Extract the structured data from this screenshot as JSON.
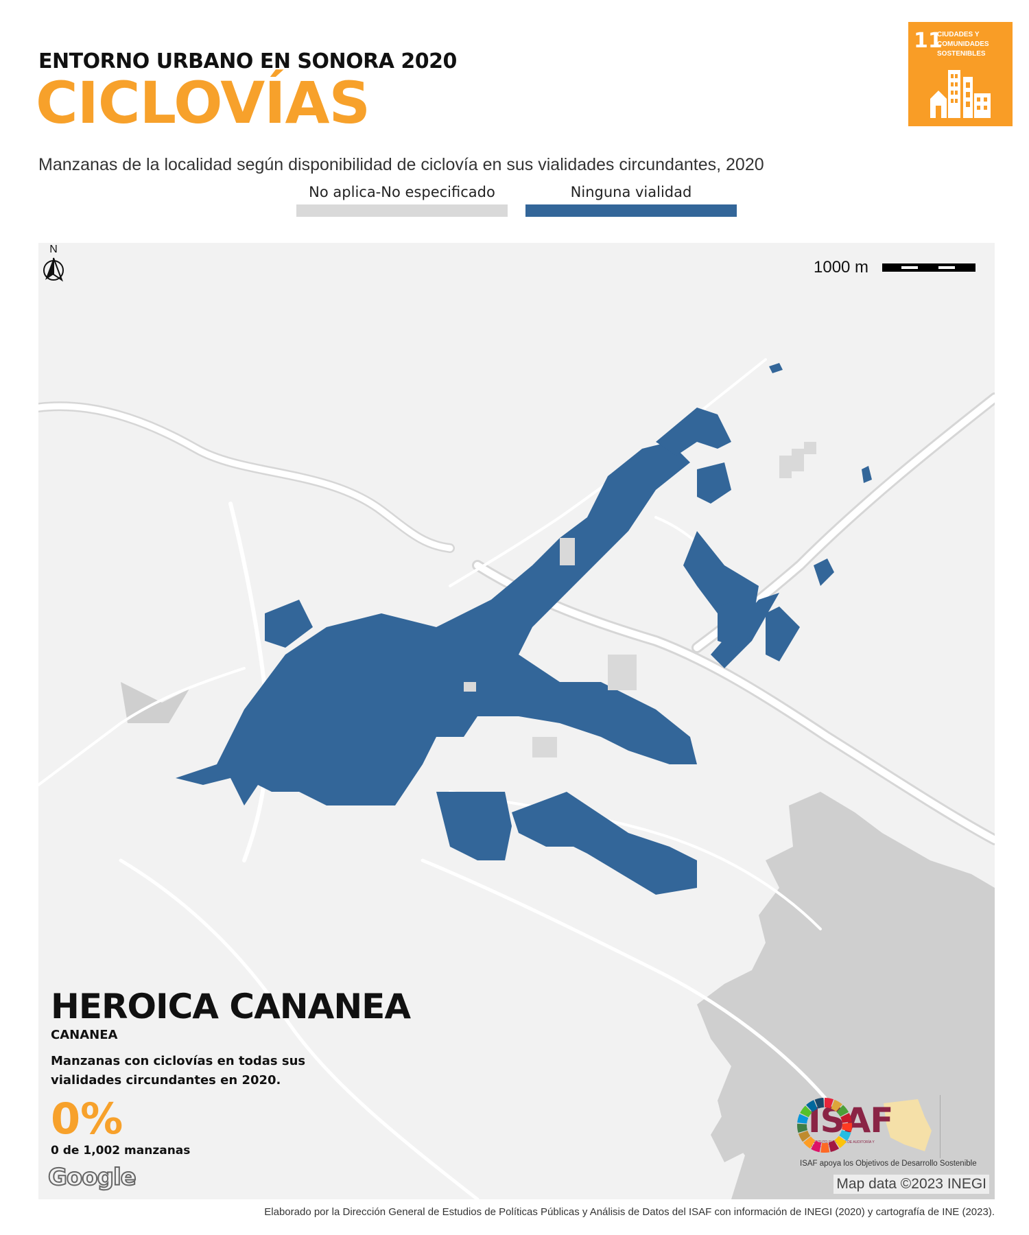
{
  "header": {
    "kicker": "ENTORNO URBANO EN SONORA 2020",
    "title": "CICLOVÍAS",
    "subtitle": "Manzanas de la localidad según disponibilidad de ciclovía en sus vialidades circundantes, 2020"
  },
  "sdg_badge": {
    "number": "11",
    "text": "CIUDADES Y COMUNIDADES SOSTENIBLES",
    "color": "#f99d26",
    "icon": "city-buildings-icon"
  },
  "legend": [
    {
      "label": "No aplica-No especificado",
      "color": "#d9d9d9"
    },
    {
      "label": "Ninguna vialidad",
      "color": "#336699"
    }
  ],
  "map": {
    "scale_label": "1000 m",
    "north_label": "N",
    "block_color": "#336699",
    "na_color": "#d9d9d9",
    "background_color": "#f2f2f2",
    "road_color": "#ffffff",
    "terrain_color": "#cfcfcf",
    "google_label": "Google",
    "attribution": "Map data ©2023 INEGI"
  },
  "locality": {
    "name": "HEROICA CANANEA",
    "municipality": "CANANEA",
    "description": "Manzanas con ciclovías en todas sus vialidades circundantes en 2020.",
    "percent": "0%",
    "count": "0 de 1,002 manzanas"
  },
  "logos": {
    "isaf_word": "ISAF",
    "isaf_subtitle": "INSTITUTO SUPERIOR DE AUDITORÍA Y FISCALIZACIÓN",
    "isaf_tagline": "ISAF apoya los Objetivos de Desarrollo Sostenible"
  },
  "footer": {
    "source": "Elaborado por la Dirección General de Estudios de Políticas Públicas y Análisis de Datos del ISAF con información de INEGI (2020) y cartografía de INE (2023)."
  }
}
